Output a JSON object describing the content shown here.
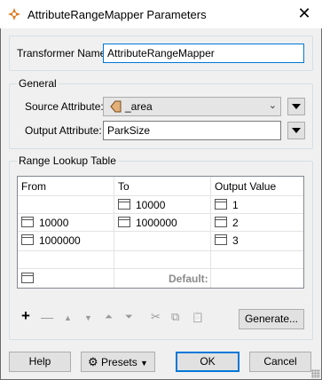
{
  "window": {
    "title": "AttributeRangeMapper Parameters",
    "close_glyph": "✕"
  },
  "transformer": {
    "label": "Transformer Name:",
    "value": "AttributeRangeMapper"
  },
  "general": {
    "legend": "General",
    "source_label": "Source Attribute:",
    "source_value": "_area",
    "output_label": "Output Attribute:",
    "output_value": "ParkSize"
  },
  "range_table": {
    "legend": "Range Lookup Table",
    "headers": [
      "From",
      "To",
      "Output Value"
    ],
    "rows": [
      {
        "from": "",
        "to": "10000",
        "output": "1"
      },
      {
        "from": "10000",
        "to": "1000000",
        "output": "2"
      },
      {
        "from": "1000000",
        "to": "",
        "output": "3"
      }
    ],
    "default_label": "Default:"
  },
  "toolbar": {
    "add": "+",
    "remove": "—",
    "up": "▲",
    "down": "▼",
    "top": "⏶",
    "bottom": "⏷",
    "cut": "✂",
    "copy": "⧉",
    "paste": "📋",
    "generate": "Generate..."
  },
  "buttons": {
    "help": "Help",
    "presets": "Presets",
    "ok": "OK",
    "cancel": "Cancel"
  },
  "colors": {
    "accent": "#0078d7",
    "icon_orange": "#e07a1f"
  }
}
